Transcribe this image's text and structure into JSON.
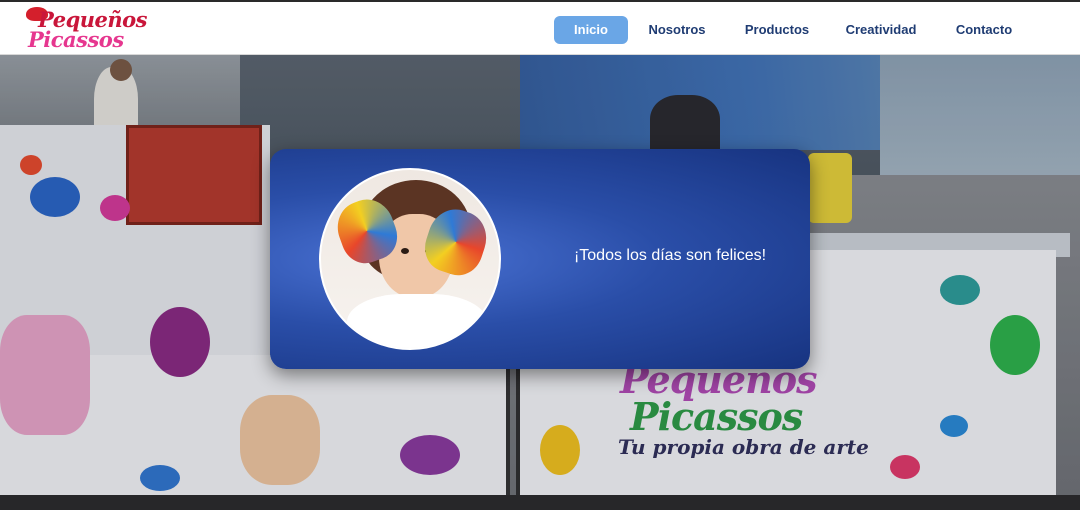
{
  "brand": {
    "logo_line1": "Pequeños",
    "logo_line2": "Picassos"
  },
  "nav": {
    "items": [
      {
        "label": "Inicio",
        "active": true
      },
      {
        "label": "Nosotros",
        "active": false
      },
      {
        "label": "Productos",
        "active": false
      },
      {
        "label": "Creatividad",
        "active": false
      },
      {
        "label": "Contacto",
        "active": false
      }
    ]
  },
  "hero": {
    "stand_brand_line1": "Pequeños",
    "stand_brand_line2": "Picassos",
    "stand_tagline": "Tu propia obra de arte"
  },
  "card": {
    "message": "¡Todos los días son felices!"
  },
  "colors": {
    "nav_text": "#1f3c73",
    "nav_active_bg": "#6aa6e6",
    "card_bg": "#2a4ea8"
  }
}
